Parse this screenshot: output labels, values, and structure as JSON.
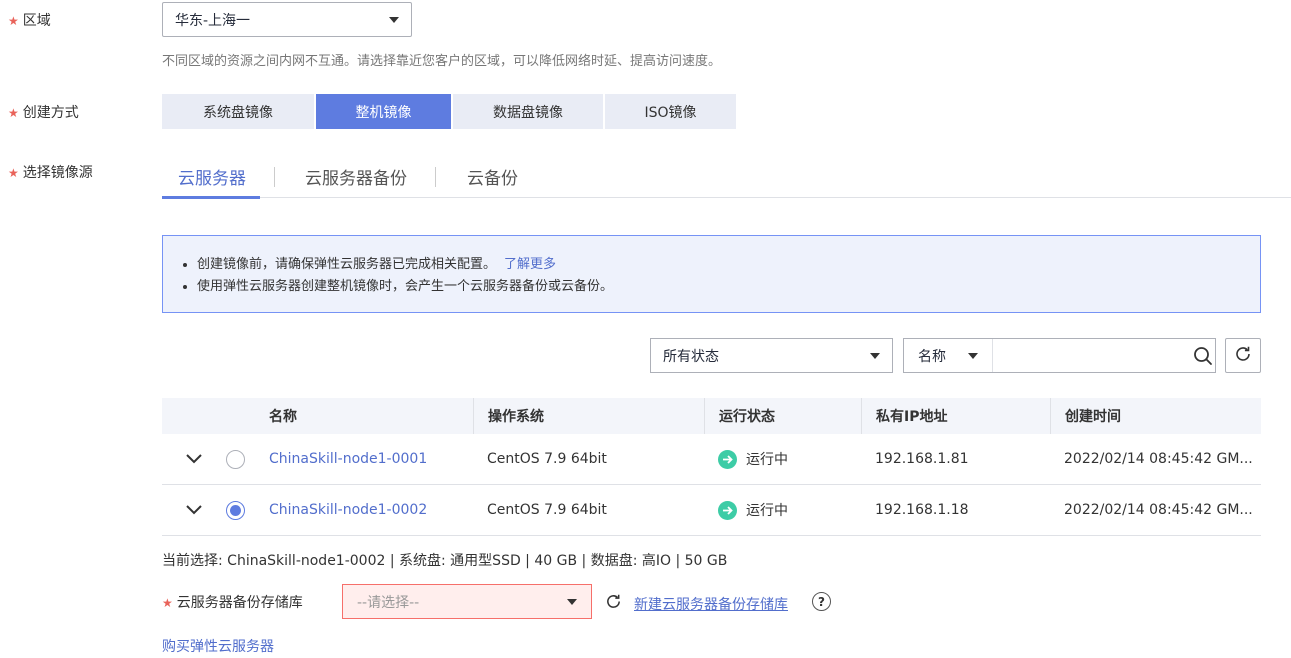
{
  "region": {
    "label": "区域",
    "value": "华东-上海一",
    "hint": "不同区域的资源之间内网不互通。请选择靠近您客户的区域，可以降低网络时延、提高访问速度。"
  },
  "creation": {
    "label": "创建方式",
    "options": [
      "系统盘镜像",
      "整机镜像",
      "数据盘镜像",
      "ISO镜像"
    ],
    "active_index": 1
  },
  "source": {
    "label": "选择镜像源",
    "tabs": [
      "云服务器",
      "云服务器备份",
      "云备份"
    ],
    "active_index": 0
  },
  "info": {
    "line1": "创建镜像前，请确保弹性云服务器已完成相关配置。",
    "learn_more": "了解更多",
    "line2": "使用弹性云服务器创建整机镜像时，会产生一个云服务器备份或云备份。"
  },
  "filter": {
    "status_value": "所有状态",
    "search_field": "名称",
    "search_placeholder": ""
  },
  "table": {
    "headers": [
      "名称",
      "操作系统",
      "运行状态",
      "私有IP地址",
      "创建时间"
    ],
    "rows": [
      {
        "name": "ChinaSkill-node1-0001",
        "os": "CentOS 7.9 64bit",
        "status": "运行中",
        "ip": "192.168.1.81",
        "created": "2022/02/14 08:45:42 GM...",
        "selected": false
      },
      {
        "name": "ChinaSkill-node1-0002",
        "os": "CentOS 7.9 64bit",
        "status": "运行中",
        "ip": "192.168.1.18",
        "created": "2022/02/14 08:45:42 GM...",
        "selected": true
      }
    ]
  },
  "current_selection": "当前选择: ChinaSkill-node1-0002 | 系统盘: 通用型SSD | 40 GB | 数据盘: 高IO | 50 GB",
  "vault": {
    "label": "云服务器备份存储库",
    "placeholder": "--请选择--",
    "create_link": "新建云服务器备份存储库"
  },
  "buy_link": "购买弹性云服务器",
  "colors": {
    "accent": "#5e7ce0",
    "link": "#526ecc",
    "required": "#e9635a",
    "running": "#3dcca6",
    "error_border": "#f66f6a"
  }
}
